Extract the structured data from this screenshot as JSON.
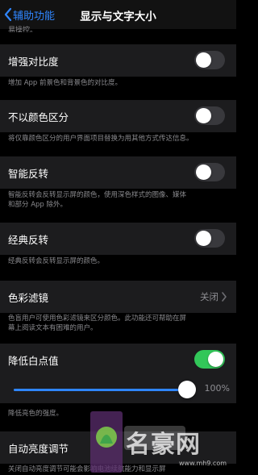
{
  "nav": {
    "back_label": "辅助功能",
    "title": "显示与文字大小"
  },
  "top_cut_text": "易操控。",
  "rows": {
    "increase_contrast": {
      "label": "增强对比度",
      "note": "增加 App 前景色和背景色的对比度。",
      "on": false
    },
    "differentiate_without_color": {
      "label": "不以颜色区分",
      "note": "将仅靠颜色区分的用户界面项目替换为用其他方式传达信息。",
      "on": false
    },
    "smart_invert": {
      "label": "智能反转",
      "note_line1": "智能反转会反转显示屏的颜色，使用深色样式的图像、媒体",
      "note_line2": "和部分 App 除外。",
      "on": false
    },
    "classic_invert": {
      "label": "经典反转",
      "note": "经典反转会反转显示屏的颜色。",
      "on": false
    },
    "color_filters": {
      "label": "色彩滤镜",
      "value": "关闭",
      "note_line1": "色盲用户可使用色彩滤镜来区分颜色。此功能还可帮助在屏",
      "note_line2": "幕上阅读文本有困难的用户。"
    },
    "reduce_white_point": {
      "label": "降低白点值",
      "on": true,
      "slider_percent": 100,
      "slider_value_text": "100%",
      "note": "降低亮色的强度。"
    },
    "auto_brightness": {
      "label": "自动亮度调节",
      "note": "关闭自动亮度调节可能会影响电池续航能力和显示屏"
    }
  },
  "watermark": {
    "text": "名豪网",
    "url": "www.mh9.com"
  },
  "colors": {
    "accent_blue": "#2f86ff",
    "toggle_on": "#32c759",
    "toggle_off": "#39393d",
    "row_bg": "#1c1c1e"
  }
}
